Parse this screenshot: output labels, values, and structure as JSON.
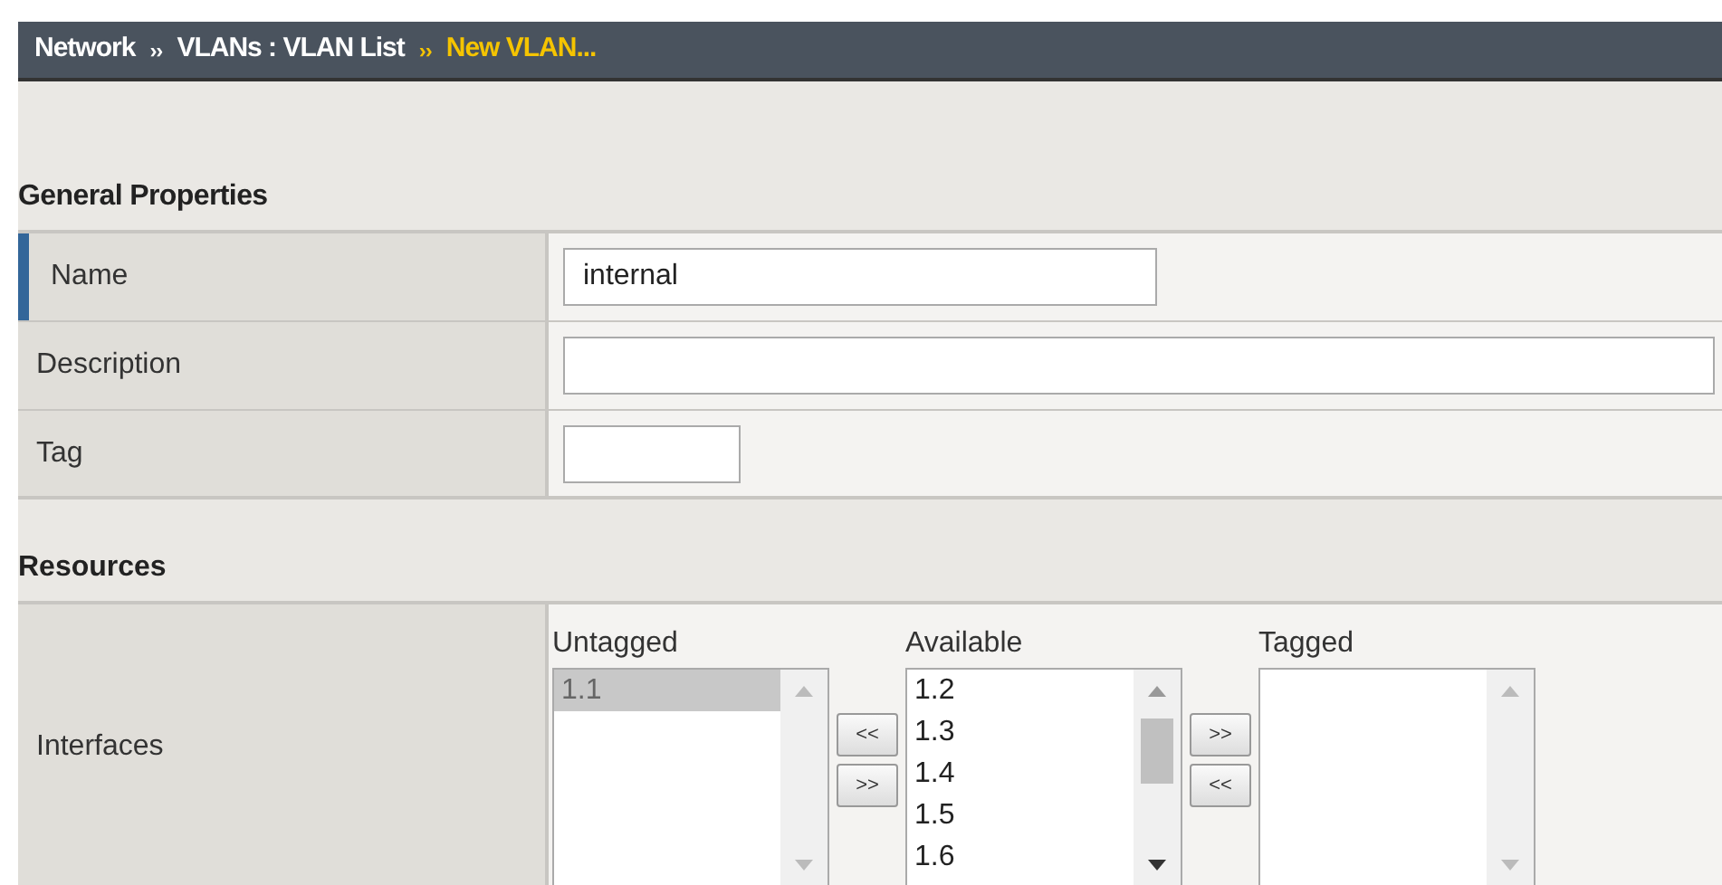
{
  "breadcrumb": {
    "items": [
      "Network",
      "VLANs : VLAN List"
    ],
    "separator": "››",
    "current": "New VLAN..."
  },
  "general_properties": {
    "title": "General Properties",
    "rows": [
      {
        "label": "Name",
        "selected": true,
        "value": "internal"
      },
      {
        "label": "Description",
        "selected": false
      },
      {
        "label": "Tag",
        "selected": false
      }
    ]
  },
  "resources": {
    "title": "Resources",
    "interfaces": {
      "label": "Interfaces",
      "lists": [
        {
          "title": "Untagged",
          "items": [
            {
              "label": "1.1",
              "selected": true
            }
          ]
        },
        {
          "title": "Available",
          "items": [
            {
              "label": "1.2",
              "selected": false
            },
            {
              "label": "1.3",
              "selected": false
            },
            {
              "label": "1.4",
              "selected": false
            },
            {
              "label": "1.5",
              "selected": false
            },
            {
              "label": "1.6",
              "selected": false
            }
          ]
        },
        {
          "title": "Tagged"
        }
      ],
      "move_buttons": [
        [
          "<<",
          ">>"
        ],
        [
          ">>",
          "<<"
        ]
      ]
    }
  }
}
